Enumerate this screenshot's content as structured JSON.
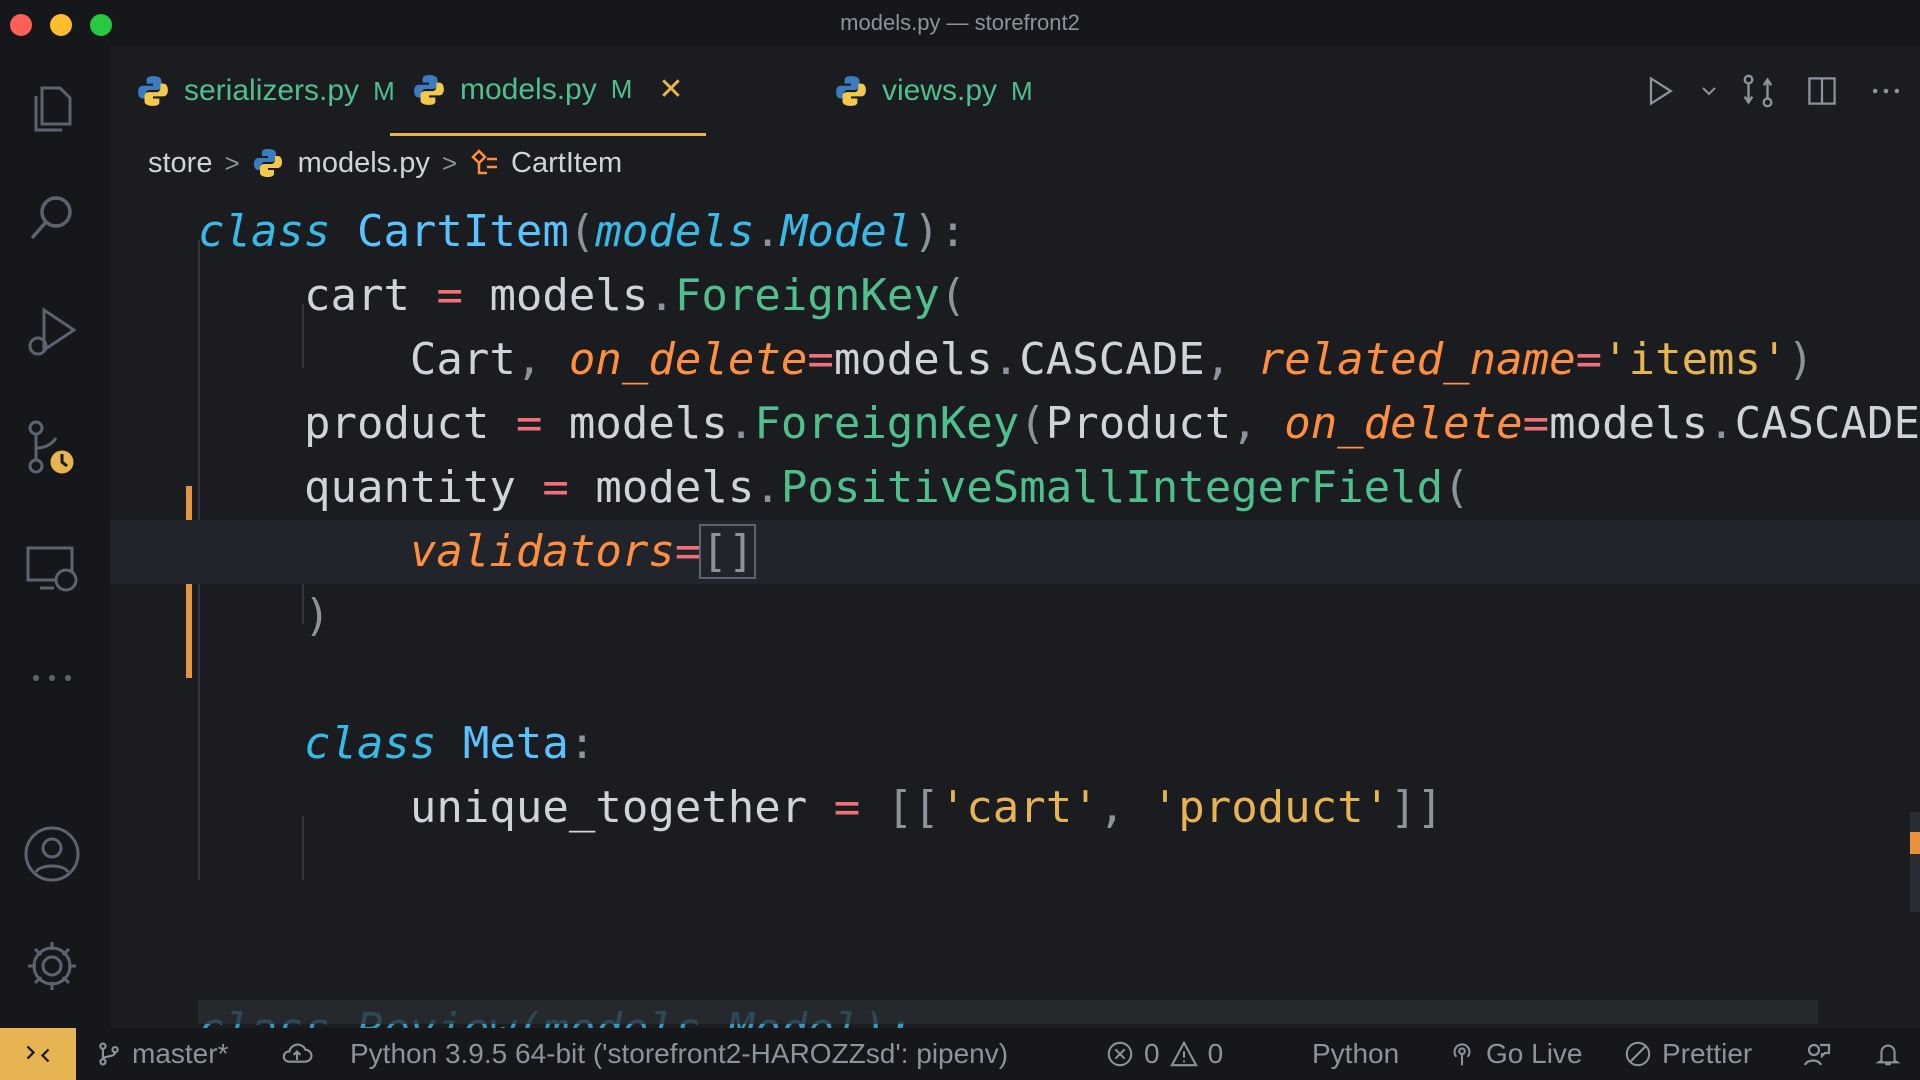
{
  "window": {
    "title": "models.py — storefront2"
  },
  "tabs": [
    {
      "label": "serializers.py",
      "badge": "M"
    },
    {
      "label": "models.py",
      "badge": "M",
      "close": "✕"
    },
    {
      "label": "views.py",
      "badge": "M"
    }
  ],
  "breadcrumb": {
    "folder": "store",
    "file": "models.py",
    "symbol": "CartItem"
  },
  "code": {
    "l1": {
      "kw": "class",
      "name": "CartItem",
      "base_mod": "models",
      "base_cls": "Model"
    },
    "l2": {
      "var": "cart",
      "mod": "models",
      "fn": "ForeignKey"
    },
    "l3": {
      "arg": "Cart",
      "p1": "on_delete",
      "v1_mod": "models",
      "v1": "CASCADE",
      "p2": "related_name",
      "v2": "'items'"
    },
    "l4": {
      "var": "product",
      "mod": "models",
      "fn": "ForeignKey",
      "arg": "Product",
      "p1": "on_delete",
      "v1_mod": "models",
      "v1": "CASCADE"
    },
    "l5": {
      "var": "quantity",
      "mod": "models",
      "fn": "PositiveSmallIntegerField"
    },
    "l6": {
      "p": "validators",
      "val": "[]"
    },
    "l7": {
      "close": ")"
    },
    "l9": {
      "kw": "class",
      "name": "Meta"
    },
    "l10": {
      "var": "unique_together",
      "s1": "'cart'",
      "s2": "'product'"
    },
    "l12": {
      "partial": "class Review(models.Model):"
    }
  },
  "status": {
    "branch": "master*",
    "python": "Python 3.9.5 64-bit ('storefront2-HAROZZsd': pipenv)",
    "errors": "0",
    "warnings": "0",
    "language": "Python",
    "golive": "Go Live",
    "prettier": "Prettier"
  },
  "colors": {
    "accent": "#e6b450",
    "modified": "#e6923e",
    "keyword": "#39bae6",
    "function": "#4fc08d",
    "parameter": "#ff8f40",
    "operator": "#f07178"
  }
}
